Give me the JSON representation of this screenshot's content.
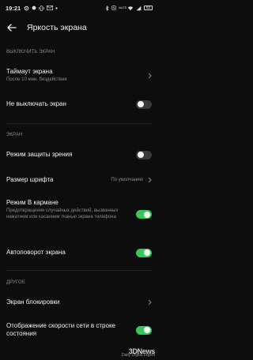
{
  "status_bar": {
    "time": "19:21",
    "icons_left": [
      "gear-icon",
      "record-icon",
      "vibrate-icon",
      "gmail-icon",
      "dot-icon"
    ],
    "icons_right": [
      "bluetooth-icon",
      "nfc-icon",
      "volte-icon",
      "wifi-icon",
      "signal-icon",
      "battery-icon"
    ],
    "volte": "VoLTE",
    "battery": "52"
  },
  "header": {
    "title": "Яркость экрана"
  },
  "sections": {
    "screen_off": "ВЫКЛЮЧИТЬ ЭКРАН",
    "screen": "ЭКРАН",
    "other": "ДРУГОЕ"
  },
  "rows": {
    "timeout": {
      "label": "Таймаут экрана",
      "sub": "После 10 мин. бездействия"
    },
    "keep_on": {
      "label": "Не выключать экран",
      "toggle": false
    },
    "eye_protect": {
      "label": "Режим защиты зрения",
      "toggle": false
    },
    "font_size": {
      "label": "Размер шрифта",
      "value": "По умолчанию"
    },
    "pocket": {
      "label": "Режим В кармане",
      "sub": "Предотвращение случайных действий, вызванных нажатием или касанием тканью экрана телефона",
      "toggle": true
    },
    "auto_rotate": {
      "label": "Автоповорот экрана",
      "toggle": true
    },
    "lock_screen": {
      "label": "Экран блокировки"
    },
    "net_speed": {
      "label": "Отображение скорости сети в строке состояния",
      "toggle": true
    }
  },
  "colors": {
    "background": "#0d0d0d",
    "toggle_on": "#35c758",
    "toggle_off": "#3a3a3a",
    "secondary_text": "#8a8a8a"
  },
  "watermark": {
    "logo": "3DNews",
    "text": "Daily Digital Digest"
  }
}
